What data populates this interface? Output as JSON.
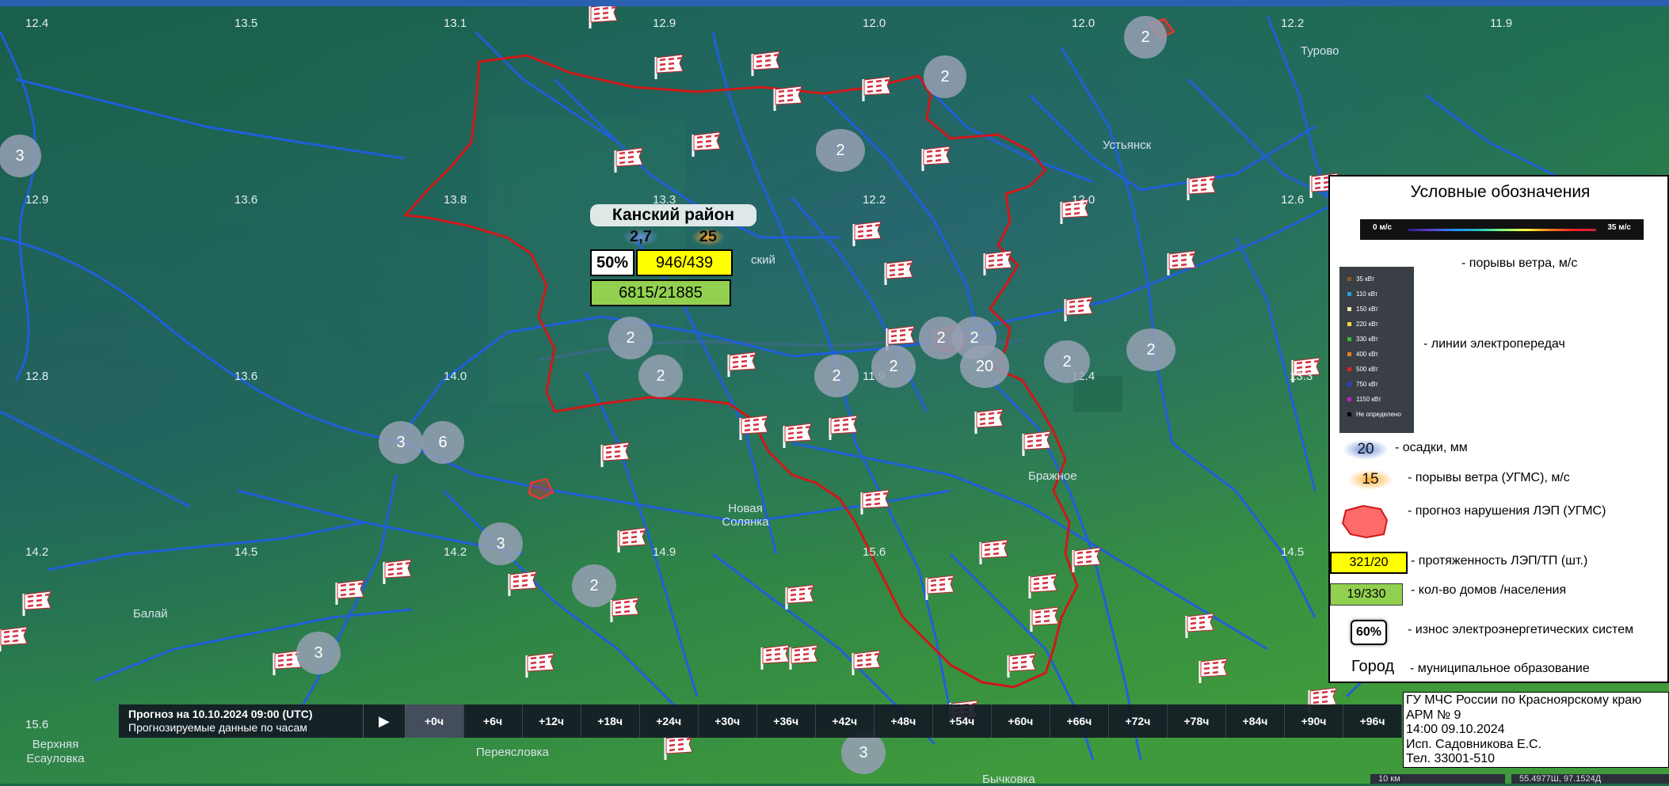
{
  "grid_labels": [
    {
      "text": "12.4"
    },
    {
      "text": "13.5"
    },
    {
      "text": "13.1"
    },
    {
      "text": "12.9"
    },
    {
      "text": "12.0"
    },
    {
      "text": "12.0"
    },
    {
      "text": "12.2"
    },
    {
      "text": "11.9"
    },
    {
      "text": "12.9"
    },
    {
      "text": "13.6"
    },
    {
      "text": "13.8"
    },
    {
      "text": "13.3"
    },
    {
      "text": "12.2"
    },
    {
      "text": "12.0"
    },
    {
      "text": "12.6"
    },
    {
      "text": "12.8"
    },
    {
      "text": "13.6"
    },
    {
      "text": "14.0"
    },
    {
      "text": "11.9"
    },
    {
      "text": "12.4"
    },
    {
      "text": "13.3"
    },
    {
      "text": "14.2"
    },
    {
      "text": "14.5"
    },
    {
      "text": "14.2"
    },
    {
      "text": "14.9"
    },
    {
      "text": "15.6"
    },
    {
      "text": "14.5"
    },
    {
      "text": "15.6"
    }
  ],
  "places": [
    {
      "text": "Турово"
    },
    {
      "text": "Устьянск"
    },
    {
      "text": "Бражное"
    },
    {
      "text": "Новая Солянка"
    },
    {
      "text": "Балай"
    },
    {
      "text": "Верхняя Есауловка"
    },
    {
      "text": "Переясловка"
    },
    {
      "text": "Бычковка"
    },
    {
      "text": "ский"
    }
  ],
  "clusters": [
    "3",
    "2",
    "2",
    "2",
    "2",
    "2",
    "2",
    "2",
    "2",
    "2",
    "20",
    "2",
    "2",
    "3",
    "6",
    "3",
    "2",
    "3",
    "3"
  ],
  "district": {
    "name": "Канский район",
    "precip": "2,7",
    "gust": "25",
    "wear": "50%",
    "lines": "946/439",
    "houses": "6815/21885"
  },
  "legend": {
    "title": "Условные обозначения",
    "wind_min": "0 м/с",
    "wind_max": "35 м/с",
    "wind_label": "- порывы ветра, м/с",
    "line_classes": [
      {
        "label": "35 кВт",
        "color": "#8b5a2b"
      },
      {
        "label": "110 кВт",
        "color": "#2aa0d8"
      },
      {
        "label": "150 кВт",
        "color": "#f3e6a0"
      },
      {
        "label": "220 кВт",
        "color": "#f0e030"
      },
      {
        "label": "330 кВт",
        "color": "#30c030"
      },
      {
        "label": "400 кВт",
        "color": "#f08020"
      },
      {
        "label": "500 кВт",
        "color": "#e02020"
      },
      {
        "label": "750 кВт",
        "color": "#2040e0"
      },
      {
        "label": "1150 кВт",
        "color": "#c020c0"
      },
      {
        "label": "Не определено",
        "color": "#000000"
      }
    ],
    "lines_label": "- линии электропередач",
    "precip_value": "20",
    "precip_label": "- осадки, мм",
    "gust_value": "15",
    "gust_label": "- порывы ветра (УГМС), м/с",
    "forecast_label": "- прогноз нарушения ЛЭП (УГМС)",
    "length_value": "321/20",
    "length_label": "- протяженность ЛЭП/ТП (шт.)",
    "houses_value": "19/330",
    "houses_label": "- кол-во домов /населения",
    "wear_value": "60%",
    "wear_label": "- износ электроэнергетических систем",
    "city_value": "Город",
    "city_label": "- муниципальное образование"
  },
  "timeline": {
    "title": "Прогноз на 10.10.2024 09:00 (UTC)",
    "subtitle": "Прогнозируемые данные по часам",
    "steps": [
      "+0ч",
      "+6ч",
      "+12ч",
      "+18ч",
      "+24ч",
      "+30ч",
      "+36ч",
      "+42ч",
      "+48ч",
      "+54ч",
      "+60ч",
      "+66ч",
      "+72ч",
      "+78ч",
      "+84ч",
      "+90ч",
      "+96ч"
    ],
    "active_step": "+0ч"
  },
  "info": {
    "line1": "ГУ МЧС России по Красноярскому  краю",
    "line2": "АРМ № 9",
    "line3": "14:00  09.10.2024",
    "line4": "Исп. Садовникова Е.С.",
    "line5": "Тел. 33001-510"
  },
  "scale_text": "10 км",
  "coords_text": "55.4977Ш, 97.1524Д",
  "colors": {
    "power_line": "#1f5fe0",
    "district_border": "#d01818",
    "map_green": "#1c7a4a",
    "yellow_box": "#ffff00",
    "green_box": "#92d050"
  }
}
